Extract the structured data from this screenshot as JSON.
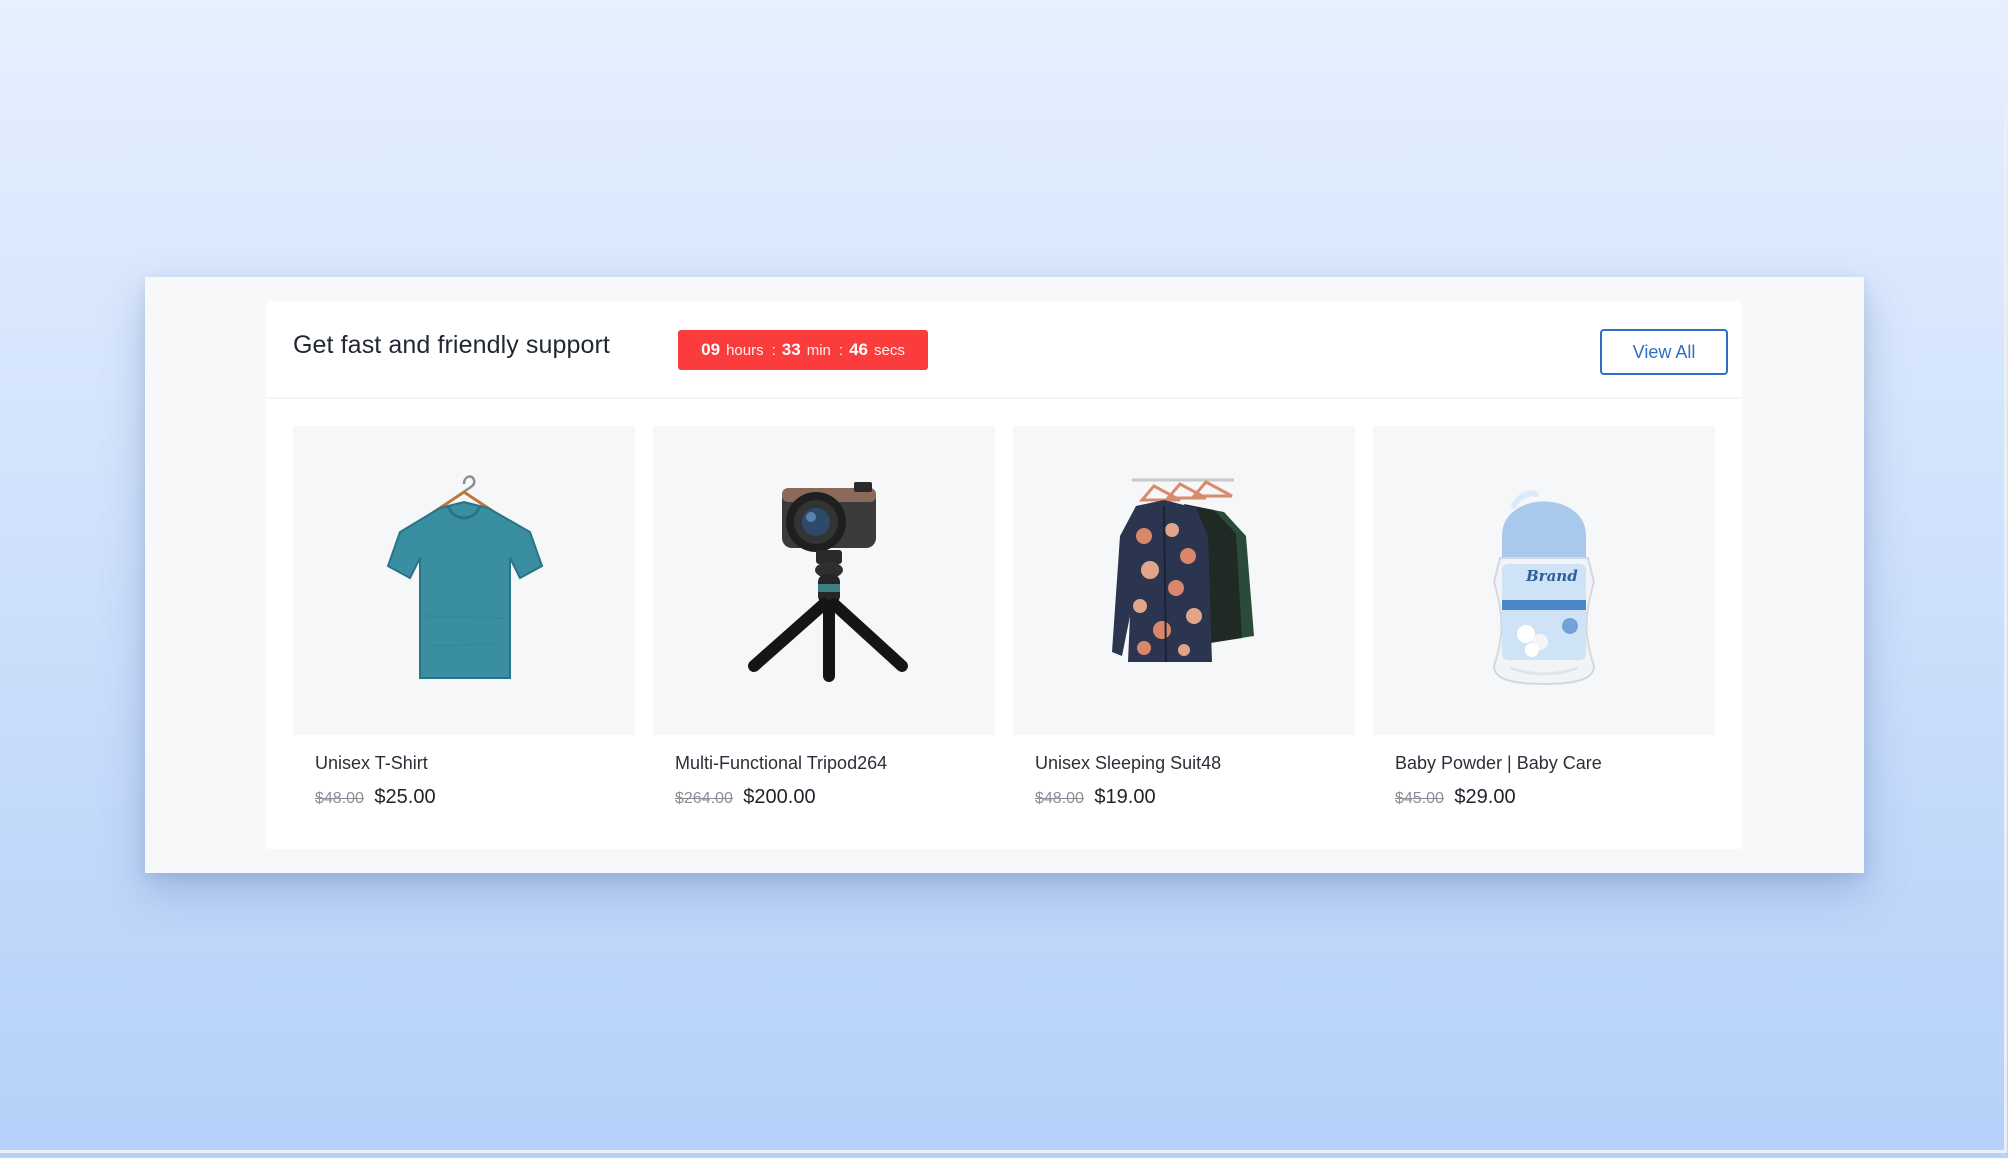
{
  "section": {
    "title": "Get fast and friendly support",
    "view_all_label": "View All"
  },
  "countdown": {
    "hours": "09",
    "hours_label": "hours",
    "minutes": "33",
    "minutes_label": "min",
    "seconds": "46",
    "seconds_label": "secs",
    "separator": ":",
    "background_color": "#fa3c3c"
  },
  "products": [
    {
      "name": "Unisex T-Shirt",
      "old_price": "$48.00",
      "price": "$25.00",
      "image_icon": "tshirt-icon"
    },
    {
      "name": "Multi-Functional Tripod264",
      "old_price": "$264.00",
      "price": "$200.00",
      "image_icon": "camera-tripod-icon"
    },
    {
      "name": "Unisex Sleeping Suit48",
      "old_price": "$48.00",
      "price": "$19.00",
      "image_icon": "sleeping-suits-icon"
    },
    {
      "name": "Baby Powder | Baby Care",
      "old_price": "$45.00",
      "price": "$29.00",
      "image_icon": "roll-on-bottle-icon",
      "bottle_label": "Brand"
    }
  ],
  "colors": {
    "accent_blue": "#2f6fc4",
    "timer_red": "#fa3c3c"
  }
}
